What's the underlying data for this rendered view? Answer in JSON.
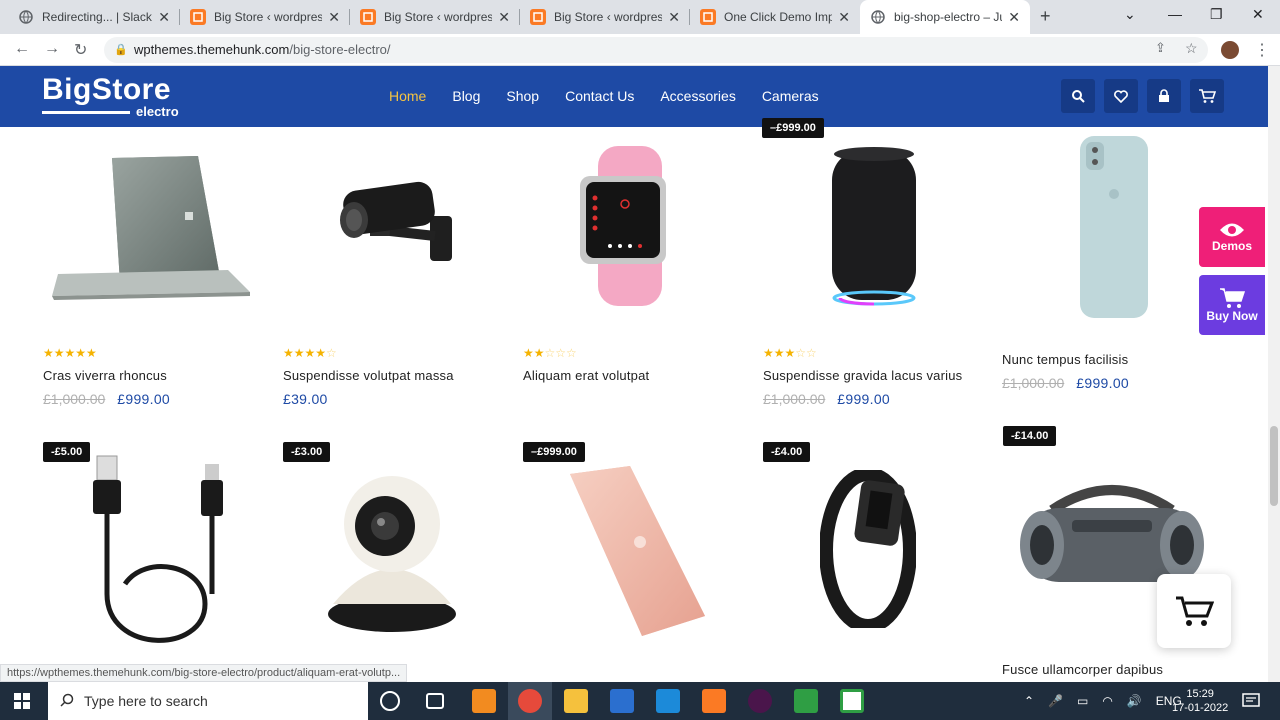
{
  "browser": {
    "tabs": [
      {
        "title": "Redirecting... | Slack",
        "fav": "globe"
      },
      {
        "title": "Big Store ‹ wordpress",
        "fav": "xampp"
      },
      {
        "title": "Big Store ‹ wordpress",
        "fav": "xampp"
      },
      {
        "title": "Big Store ‹ wordpress",
        "fav": "xampp"
      },
      {
        "title": "One Click Demo Impo",
        "fav": "xampp"
      },
      {
        "title": "big-shop-electro – Ju",
        "fav": "globe"
      }
    ],
    "url_host": "wpthemes.themehunk.com",
    "url_path": "/big-store-electro/"
  },
  "site": {
    "logo_big": "BigStore",
    "logo_small": "electro",
    "menu": [
      "Home",
      "Blog",
      "Shop",
      "Contact Us",
      "Accessories",
      "Cameras"
    ],
    "header_icons": [
      "search-icon",
      "heart-icon",
      "lock-icon",
      "cart-icon"
    ]
  },
  "products_row1": [
    {
      "badge": "",
      "rating": 5,
      "name": "Cras viverra rhoncus",
      "old": "£1,000.00",
      "price": "£999.00"
    },
    {
      "badge": "",
      "rating": 4,
      "name": "Suspendisse volutpat massa",
      "old": "",
      "price": "£39.00"
    },
    {
      "badge": "",
      "rating": 2,
      "name": "Aliquam erat volutpat",
      "old": "",
      "price": ""
    },
    {
      "badge": "–£999.00",
      "rating": 3,
      "name": "Suspendisse gravida lacus varius",
      "old": "£1,000.00",
      "price": "£999.00"
    },
    {
      "badge": "",
      "rating": 0,
      "name": "Nunc tempus facilisis",
      "old": "£1,000.00",
      "price": "£999.00"
    }
  ],
  "products_row2": [
    {
      "badge": "-£5.00",
      "name": ""
    },
    {
      "badge": "-£3.00",
      "name": ""
    },
    {
      "badge": "–£999.00",
      "name": ""
    },
    {
      "badge": "-£4.00",
      "name": ""
    },
    {
      "badge": "-£14.00",
      "name": "Fusce ullamcorper dapibus"
    }
  ],
  "side_buttons": {
    "demos": "Demos",
    "buy": "Buy Now"
  },
  "status_url": "https://wpthemes.themehunk.com/big-store-electro/product/aliquam-erat-volutp...",
  "taskbar": {
    "search_placeholder": "Type here to search",
    "lang": "ENG",
    "time": "15:29",
    "date": "17-01-2022"
  }
}
